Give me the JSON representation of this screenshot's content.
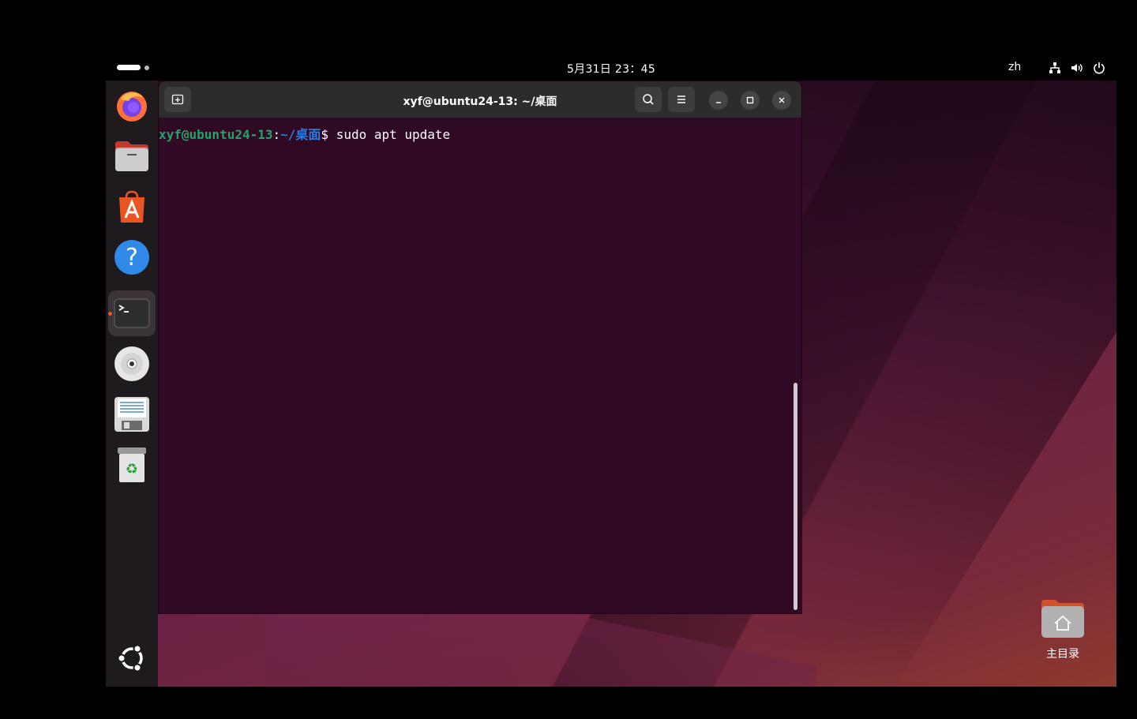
{
  "topbar": {
    "clock": "5月31日 23：45",
    "input_method": "zh",
    "tray_icons": [
      "network-icon",
      "volume-icon",
      "power-icon"
    ]
  },
  "dock": {
    "items": [
      {
        "name": "firefox",
        "icon": "firefox-icon"
      },
      {
        "name": "files",
        "icon": "files-icon"
      },
      {
        "name": "app-center",
        "icon": "app-center-icon"
      },
      {
        "name": "help",
        "icon": "help-icon"
      },
      {
        "name": "terminal",
        "icon": "terminal-icon",
        "running": true
      },
      {
        "name": "disc",
        "icon": "disc-icon"
      },
      {
        "name": "floppy-save",
        "icon": "floppy-icon"
      },
      {
        "name": "trash",
        "icon": "trash-icon"
      }
    ],
    "show_apps_icon": "ubuntu-logo-icon"
  },
  "terminal": {
    "title": "xyf@ubuntu24-13: ~/桌面",
    "prompt_user": "xyf@ubuntu24-13",
    "prompt_sep": ":",
    "prompt_path": "~/桌面",
    "prompt_symbol": "$ ",
    "command": "sudo apt update"
  },
  "desktop": {
    "home_label": "主目录"
  },
  "colors": {
    "accent": "#e95420",
    "terminal_bg": "#300a24",
    "prompt_user": "#26a269",
    "prompt_path": "#2a7bde"
  }
}
